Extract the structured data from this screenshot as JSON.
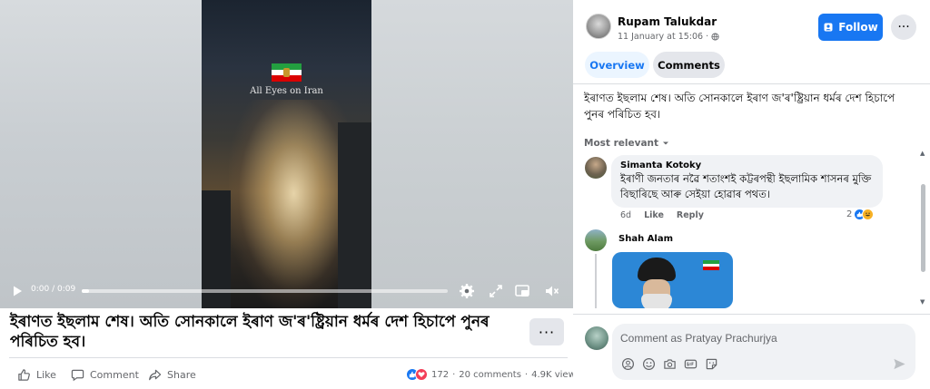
{
  "video": {
    "caption": "All Eyes on Iran",
    "time": "0:00 / 0:09",
    "progress": 0.02
  },
  "post": {
    "title": "ইৰাণত ইছলাম শেষ। অতি সোনকালে ইৰাণ জ'ৰ'ষ্ট্ৰিয়ান ধৰ্মৰ দেশ হিচাপে পুনৰ পৰিচিত হব।",
    "text": "ইৰাণত ইছলাম শেষ। অতি সোনকালে ইৰাণ জ'ৰ'ষ্ট্ৰিয়ান ধৰ্মৰ দেশ হিচাপে পুনৰ পৰিচিত হব।",
    "more_label": "···"
  },
  "actions": {
    "like": "Like",
    "comment": "Comment",
    "share": "Share"
  },
  "stats": {
    "reactions": "172",
    "comments": "20 comments",
    "views": "4.9K views",
    "separator": "·"
  },
  "author": {
    "name": "Rupam Talukdar",
    "time": "11 January at 15:06 ·"
  },
  "header": {
    "follow_label": "Follow",
    "more_label": "···"
  },
  "tabs": [
    {
      "label": "Overview",
      "active": true
    },
    {
      "label": "Comments",
      "active": false
    }
  ],
  "sort_label": "Most relevant",
  "comments": [
    {
      "name": "Simanta Kotoky",
      "text": "ইৰাণী জনতাৰ নৱৈ শতাংশই কট্টৰপন্থী ইছলামিক শাসনৰ মুক্তি বিছাৰিছে আৰু সেইয়া হোৱাৰ পথত।",
      "age": "6d",
      "like": "Like",
      "reply": "Reply",
      "reaction_count": "2"
    },
    {
      "name": "Shah Alam"
    }
  ],
  "composer": {
    "placeholder": "Comment as Pratyay Prachurjya"
  },
  "icons": {
    "play": "play-icon",
    "settings": "gear-icon",
    "expand": "expand-icon",
    "pip": "picture-in-picture-icon",
    "fullscreen": "fullscreen-icon",
    "volume": "volume-icon",
    "globe": "globe-icon",
    "follow": "add-user-icon"
  },
  "colors": {
    "brand": "#1877f2",
    "like": "#1877f2",
    "love": "#f33e58",
    "haha": "#f7b125"
  }
}
